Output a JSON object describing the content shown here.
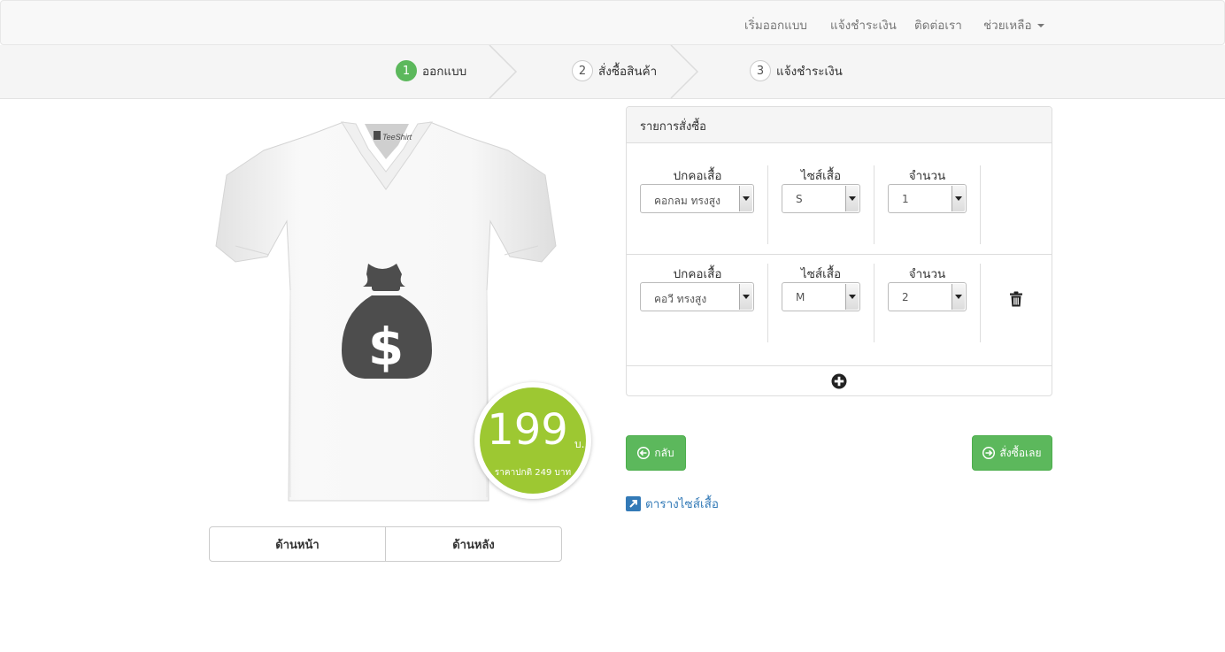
{
  "navbar": {
    "items": [
      {
        "label": "เริ่มออกแบบ"
      },
      {
        "label": "แจ้งชำระเงิน"
      },
      {
        "label": "ติดต่อเรา"
      },
      {
        "label": "ช่วยเหลือ"
      }
    ]
  },
  "steps": [
    {
      "number": "1",
      "label": "ออกแบบ",
      "active": true
    },
    {
      "number": "2",
      "label": "สั่งซื้อสินค้า",
      "active": false
    },
    {
      "number": "3",
      "label": "แจ้งชำระเงิน",
      "active": false
    }
  ],
  "product": {
    "tag_brand": "TeeShirt",
    "price": "199",
    "price_unit": "บ.",
    "regular_price_note": "ราคาปกติ 249 บาท",
    "accent_color": "#9dc832",
    "print_icon": "money-bag-icon"
  },
  "views": {
    "front_label": "ด้านหน้า",
    "back_label": "ด้านหลัง"
  },
  "order": {
    "heading": "รายการสั่งซื้อ",
    "columns": {
      "collar": "ปกคอเสื้อ",
      "size": "ไซส์เสื้อ",
      "quantity": "จำนวน"
    },
    "rows": [
      {
        "collar": "คอกลม ทรงสูง",
        "size": "S",
        "quantity": "1"
      },
      {
        "collar": "คอวี ทรงสูง",
        "size": "M",
        "quantity": "2"
      }
    ]
  },
  "actions": {
    "back_label": "กลับ",
    "order_label": "สั่งซื้อเลย",
    "size_chart_label": "ตารางไซส์เสื้อ",
    "button_color": "#5cb85c",
    "link_color": "#337ab7"
  }
}
